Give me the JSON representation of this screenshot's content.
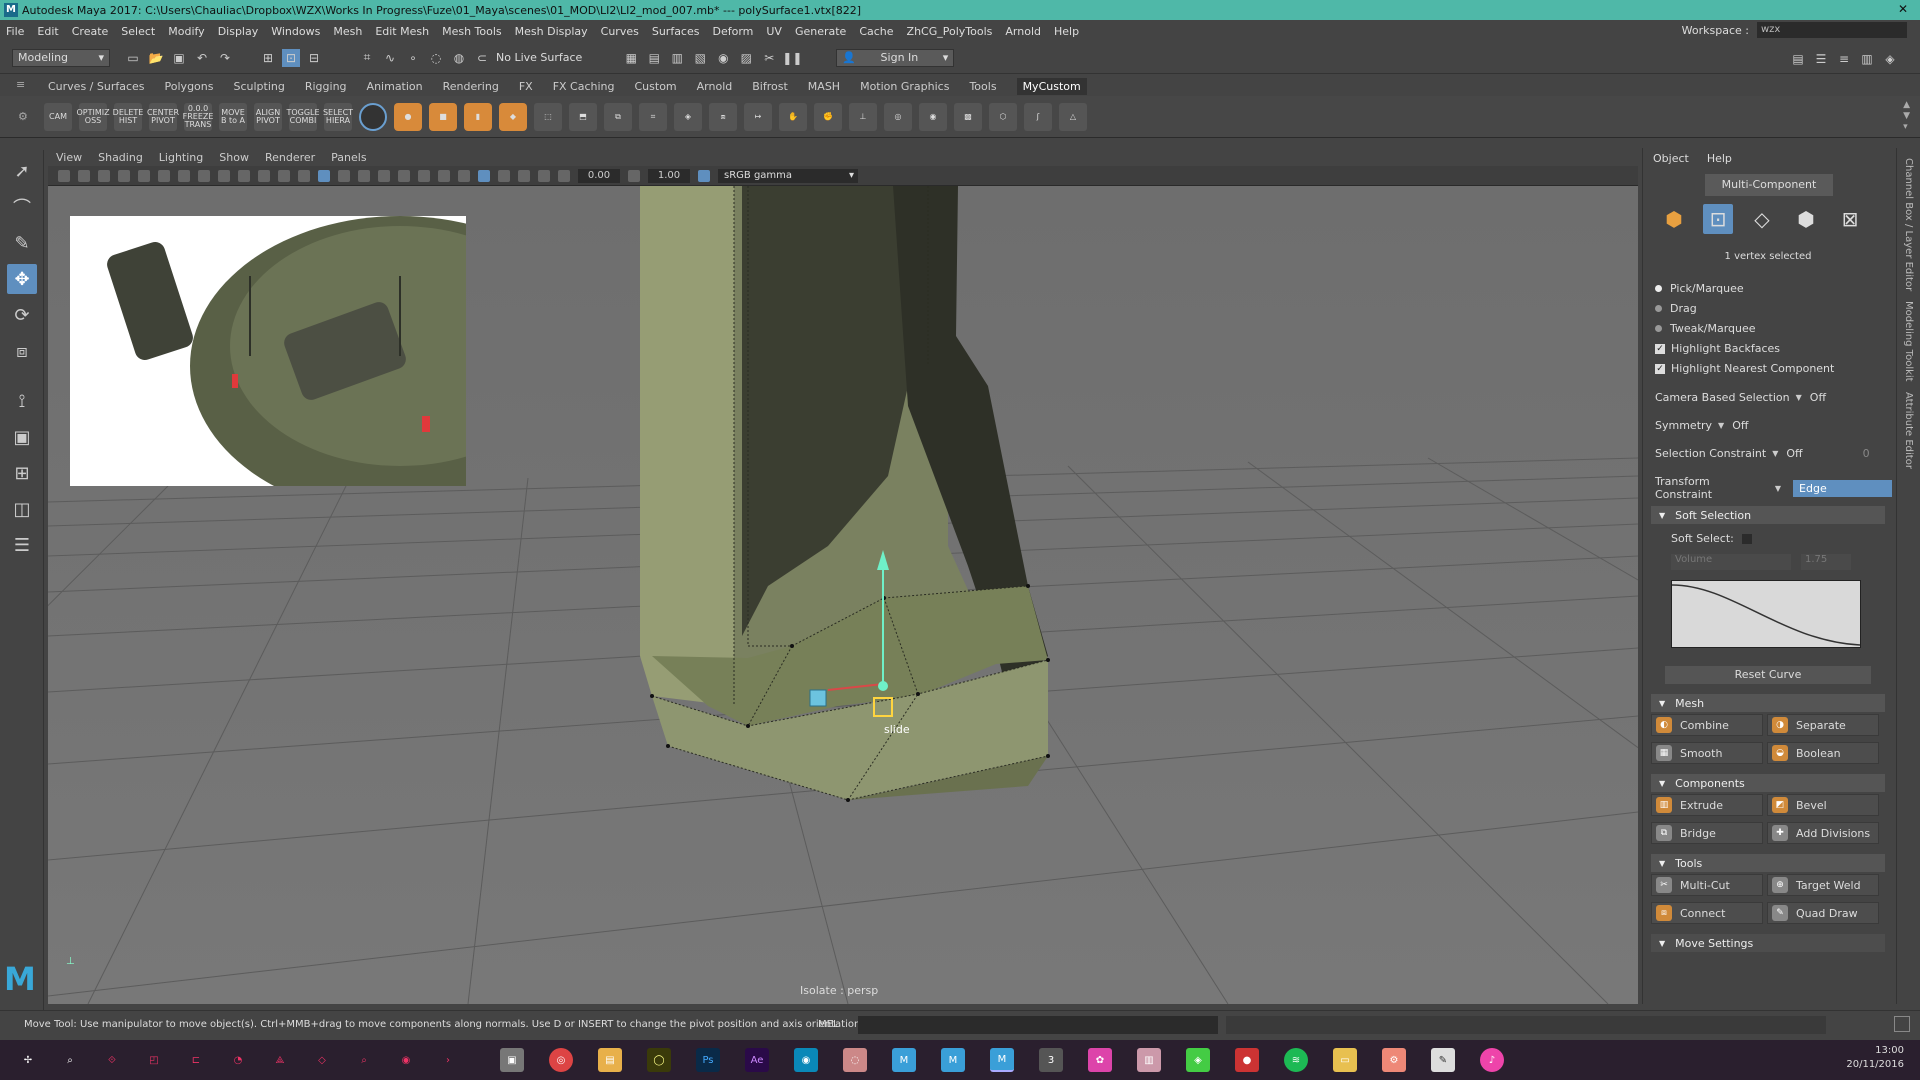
{
  "app": {
    "title": "Autodesk Maya 2017: C:\\Users\\Chauliac\\Dropbox\\WZX\\Works In Progress\\Fuze\\01_Maya\\scenes\\01_MOD\\LI2\\LI2_mod_007.mb*   ---   polySurface1.vtx[822]",
    "logo": "M"
  },
  "menubar": {
    "items": [
      "File",
      "Edit",
      "Create",
      "Select",
      "Modify",
      "Display",
      "Windows",
      "Mesh",
      "Edit Mesh",
      "Mesh Tools",
      "Mesh Display",
      "Curves",
      "Surfaces",
      "Deform",
      "UV",
      "Generate",
      "Cache",
      "ZhCG_PolyTools",
      "Arnold",
      "Help"
    ],
    "workspace_label": "Workspace :",
    "workspace_value": "wzx"
  },
  "statusline": {
    "menuset": "Modeling",
    "live_surface": "No Live Surface",
    "sign_in": "Sign In"
  },
  "shelf": {
    "tabs": [
      "Curves / Surfaces",
      "Polygons",
      "Sculpting",
      "Rigging",
      "Animation",
      "Rendering",
      "FX",
      "FX Caching",
      "Custom",
      "Arnold",
      "Bifrost",
      "MASH",
      "Motion Graphics",
      "Tools",
      "MyCustom"
    ],
    "active_tab": "MyCustom",
    "text_icons": [
      {
        "label": "CAM",
        "icon": "camera-icon"
      },
      {
        "label": "OPTIMIZ OSS",
        "icon": "optimize-icon"
      },
      {
        "label": "DELETE HIST",
        "icon": "delete-history-icon"
      },
      {
        "label": "CENTER PIVOT",
        "icon": "center-pivot-icon"
      },
      {
        "label": "0.0.0 FREEZE TRANS",
        "icon": "freeze-transform-icon"
      },
      {
        "label": "MOVE B to A",
        "icon": "move-b-to-a-icon"
      },
      {
        "label": "ALIGN PIVOT",
        "icon": "align-pivot-icon"
      },
      {
        "label": "TOGGLE COMBI",
        "icon": "toggle-combine-icon"
      },
      {
        "label": "SELECT HIERA",
        "icon": "select-hierarchy-icon"
      }
    ]
  },
  "viewport": {
    "menus": [
      "View",
      "Shading",
      "Lighting",
      "Show",
      "Renderer",
      "Panels"
    ],
    "exposure": "0.00",
    "gamma": "1.00",
    "color_space": "sRGB gamma",
    "camera_label": "Isolate : persp",
    "manip_label": "slide"
  },
  "modeling_toolkit": {
    "tabs": [
      "Object",
      "Help"
    ],
    "multi_component": "Multi-Component",
    "selection_info": "1 vertex selected",
    "pick_modes": [
      "Pick/Marquee",
      "Drag",
      "Tweak/Marquee"
    ],
    "active_pick_mode": "Pick/Marquee",
    "highlight_backfaces": "Highlight Backfaces",
    "highlight_nearest": "Highlight Nearest Component",
    "camera_based_selection": {
      "label": "Camera Based Selection",
      "value": "Off"
    },
    "symmetry": {
      "label": "Symmetry",
      "value": "Off"
    },
    "selection_constraint": {
      "label": "Selection Constraint",
      "value": "Off",
      "num": "0"
    },
    "transform_constraint": {
      "label": "Transform Constraint",
      "value": "Edge"
    },
    "soft_selection": {
      "title": "Soft Selection",
      "soft_select_label": "Soft Select:",
      "falloff": "Volume",
      "radius": "1.75",
      "reset_curve": "Reset Curve"
    },
    "mesh": {
      "title": "Mesh",
      "buttons": [
        "Combine",
        "Separate",
        "Smooth",
        "Boolean"
      ]
    },
    "components": {
      "title": "Components",
      "buttons": [
        "Extrude",
        "Bevel",
        "Bridge",
        "Add Divisions"
      ]
    },
    "tools": {
      "title": "Tools",
      "buttons": [
        "Multi-Cut",
        "Target Weld",
        "Connect",
        "Quad Draw"
      ]
    },
    "move_settings": "Move Settings"
  },
  "side_tabs": [
    "Channel Box / Layer Editor",
    "Modeling Toolkit",
    "Attribute Editor"
  ],
  "helpline": {
    "text": "Move Tool: Use manipulator to move object(s). Ctrl+MMB+drag to move components along normals. Use D or INSERT to change the pivot position and axis orientation.",
    "mel": "MEL"
  },
  "taskbar": {
    "time": "13:00",
    "date": "20/11/2016",
    "apps": [
      "file-explorer-icon",
      "chrome-icon",
      "notes-icon",
      "illustrator-icon",
      "photoshop-icon",
      "after-effects-icon",
      "browser-icon",
      "app-icon",
      "maya-icon",
      "maya-icon-2",
      "maya-icon-3",
      "3dsmax-icon",
      "paint-icon",
      "archive-icon",
      "vpn-icon",
      "recorder-icon",
      "spotify-icon",
      "folder-icon",
      "settings-icon",
      "notepad-icon",
      "itunes-icon"
    ]
  },
  "colors": {
    "titlebar": "#4fb8a8",
    "accent_blue": "#5f8fbf",
    "shelf_orange": "#d88a3a",
    "viewport_bg": "#6f6f6f",
    "model_green": "#8a9266"
  }
}
